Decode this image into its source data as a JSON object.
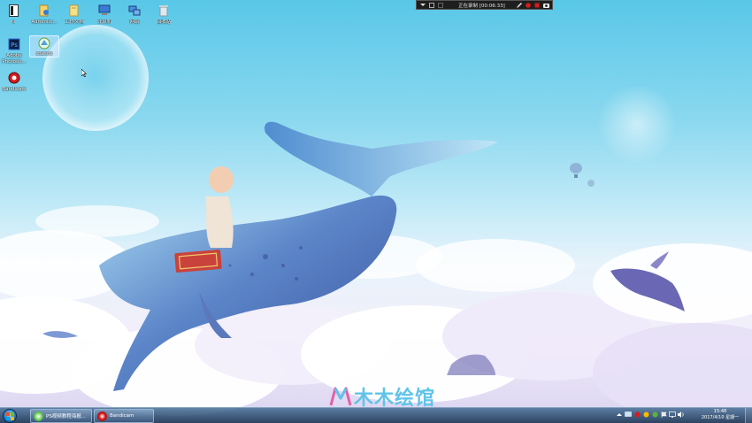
{
  "desktop_icons": [
    {
      "label": "ti",
      "icon": "file-icon"
    },
    {
      "label": "Administ...",
      "icon": "user-folder-icon"
    },
    {
      "label": "工作文档",
      "icon": "folder-icon"
    },
    {
      "label": "计算机",
      "icon": "computer-icon"
    },
    {
      "label": "网络",
      "icon": "network-icon"
    },
    {
      "label": "回收站",
      "icon": "recycle-bin-icon"
    },
    {
      "label": "Adobe Photosh...",
      "icon": "photoshop-icon"
    },
    {
      "label": "sdasde",
      "icon": "app-icon"
    },
    {
      "label": "Bandicam",
      "icon": "bandicam-icon"
    }
  ],
  "recording_bar": {
    "status": "正在录制 [00:06:33]",
    "buttons": [
      "dropdown-icon",
      "pen-icon",
      "record-icon",
      "stop-icon",
      "camera-icon"
    ]
  },
  "watermark": {
    "text": "木木绘馆"
  },
  "taskbar": {
    "tasks": [
      {
        "label": "PS视频教程海报...",
        "icon": "browser-icon"
      },
      {
        "label": "Bandicam",
        "icon": "bandicam-icon"
      }
    ],
    "clock": {
      "time": "15:48",
      "date": "2017/4/10 星期一"
    }
  },
  "colors": {
    "sky": "#59c7e8",
    "taskbar": "#1e3755",
    "record_red": "#d81b1b",
    "watermark": "#5fc4ea"
  }
}
